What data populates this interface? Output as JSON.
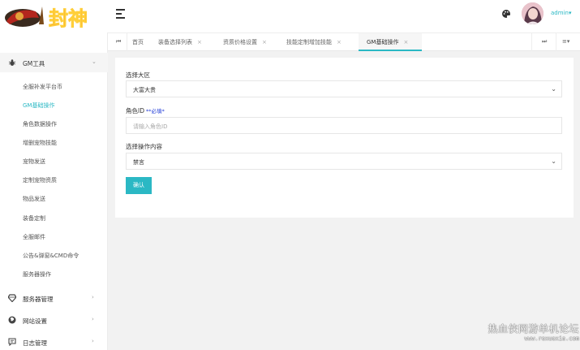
{
  "header": {
    "logo_text": "封神",
    "username": "admin",
    "user_caret": "▾"
  },
  "sidebar": {
    "groups": [
      {
        "label": "GM工具",
        "arrow": "⌄"
      },
      {
        "label": "服务器管理",
        "arrow": "›"
      },
      {
        "label": "网站设置",
        "arrow": "›"
      },
      {
        "label": "日志管理",
        "arrow": "›"
      }
    ],
    "items": [
      {
        "label": "全服补发平台币"
      },
      {
        "label": "GM基础操作"
      },
      {
        "label": "角色数据操作"
      },
      {
        "label": "增删宠物技能"
      },
      {
        "label": "宠物发送"
      },
      {
        "label": "定制宠物资质"
      },
      {
        "label": "物品发送"
      },
      {
        "label": "装备定制"
      },
      {
        "label": "全服邮件"
      },
      {
        "label": "公告&弹窗&CMD命令"
      },
      {
        "label": "服务器操作"
      }
    ]
  },
  "tabs": {
    "prev": "⏮",
    "next": "⏭",
    "menu": "≡▾",
    "close": "×",
    "items": [
      {
        "label": "首页"
      },
      {
        "label": "装备选择列表"
      },
      {
        "label": "资质价格设置"
      },
      {
        "label": "技能定制增加技能"
      },
      {
        "label": "GM基础操作"
      }
    ]
  },
  "form": {
    "server_label": "选择大区",
    "server_value": "大富大贵",
    "role_label": "角色ID",
    "role_required": "**必填*",
    "role_placeholder": "请输入角色ID",
    "action_label": "选择操作内容",
    "action_value": "禁言",
    "chevron": "⌄",
    "submit_label": "确认"
  },
  "watermark": {
    "title": "热血侠网游单机论坛",
    "url": "www.rexuexia.com"
  },
  "colors": {
    "accent": "#2bb8c4",
    "required": "#1f3ad6"
  }
}
